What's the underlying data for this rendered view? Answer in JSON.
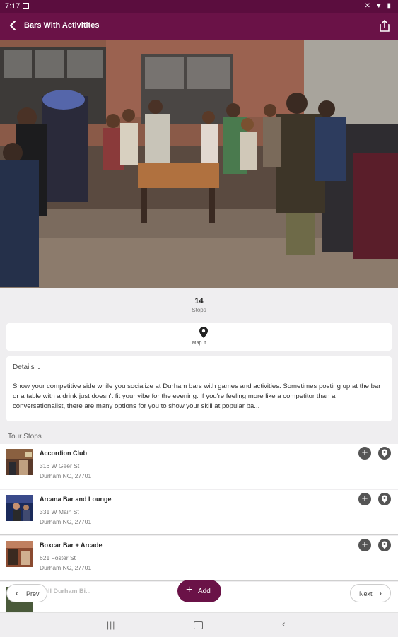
{
  "status": {
    "time": "7:17",
    "icons": "mute-icon wifi-icon battery-icon"
  },
  "appbar": {
    "title": "Bars With Activitites",
    "back_icon": "back-arrow-icon",
    "share_icon": "share-icon"
  },
  "hero": {
    "alt_icon": "photo-bar-arcade"
  },
  "stops": {
    "count": "14",
    "label": "Stops"
  },
  "map": {
    "label": "Map It",
    "icon": "map-pin-icon"
  },
  "details": {
    "header": "Details",
    "text": "Show your competitive side while you socialize at Durham bars with games and activities. Sometimes posting up at the bar or a table with a drink just doesn't fit your vibe for the evening. If you're feeling more like a competitor than a conversationalist, there are many options for you to show your skill at popular ba..."
  },
  "tour": {
    "label": "Tour Stops",
    "items": [
      {
        "name": "Accordion Club",
        "addr1": "316 W Geer St",
        "addr2": "Durham NC, 27701"
      },
      {
        "name": "Arcana Bar and Lounge",
        "addr1": "331 W Main St",
        "addr2": "Durham NC, 27701"
      },
      {
        "name": "Boxcar Bar + Arcade",
        "addr1": "621 Foster St",
        "addr2": "Durham NC, 27701"
      },
      {
        "name": "Bull Durham Bi...",
        "addr1": "",
        "addr2": ""
      }
    ]
  },
  "buttons": {
    "prev": "Prev",
    "add": "Add",
    "next": "Next"
  },
  "colors": {
    "primary": "#6a1247",
    "status": "#5b0d3e",
    "icon_gray": "#555555"
  }
}
